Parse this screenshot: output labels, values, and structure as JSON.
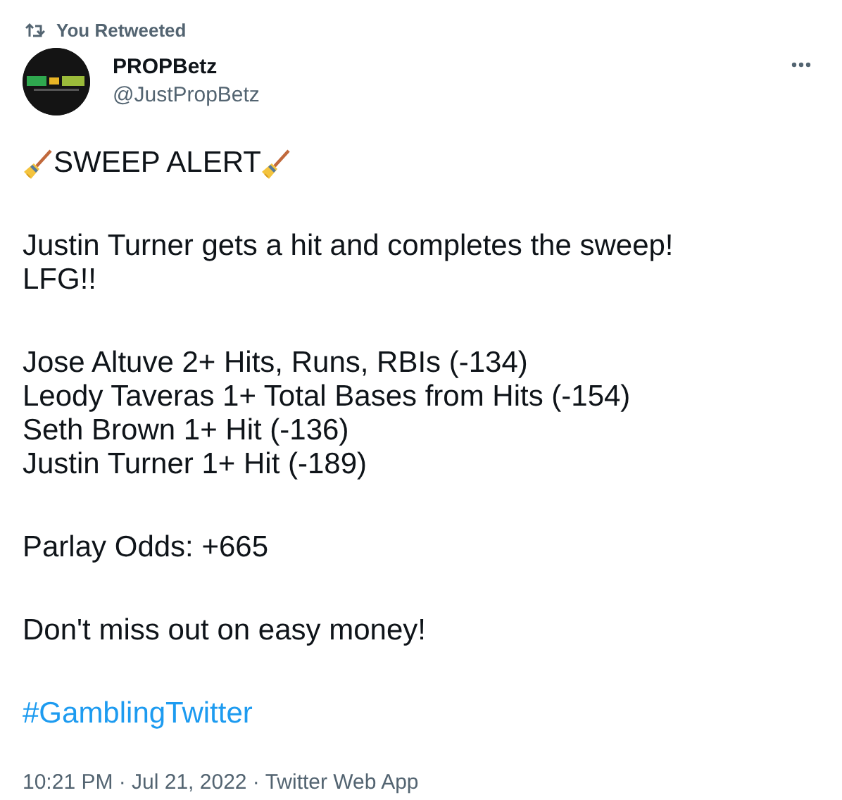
{
  "social_context": "You Retweeted",
  "author": {
    "name": "PROPBetz",
    "handle": "@JustPropBetz"
  },
  "headline": "SWEEP ALERT",
  "paragraphs": [
    {
      "kind": "text",
      "lines": [
        "Justin Turner gets a hit and completes the sweep!",
        "LFG!!"
      ]
    },
    {
      "kind": "text",
      "lines": [
        "Jose Altuve 2+ Hits, Runs, RBIs (-134)",
        "Leody Taveras 1+ Total Bases from Hits (-154)",
        "Seth Brown 1+ Hit (-136)",
        "Justin Turner 1+ Hit (-189)"
      ]
    },
    {
      "kind": "text",
      "lines": [
        "Parlay Odds: +665"
      ]
    },
    {
      "kind": "text",
      "lines": [
        "Don't miss out on easy money!"
      ]
    },
    {
      "kind": "hashtag",
      "lines": [
        "#GamblingTwitter"
      ]
    }
  ],
  "meta": "10:21 PM · Jul 21, 2022 · Twitter Web App"
}
